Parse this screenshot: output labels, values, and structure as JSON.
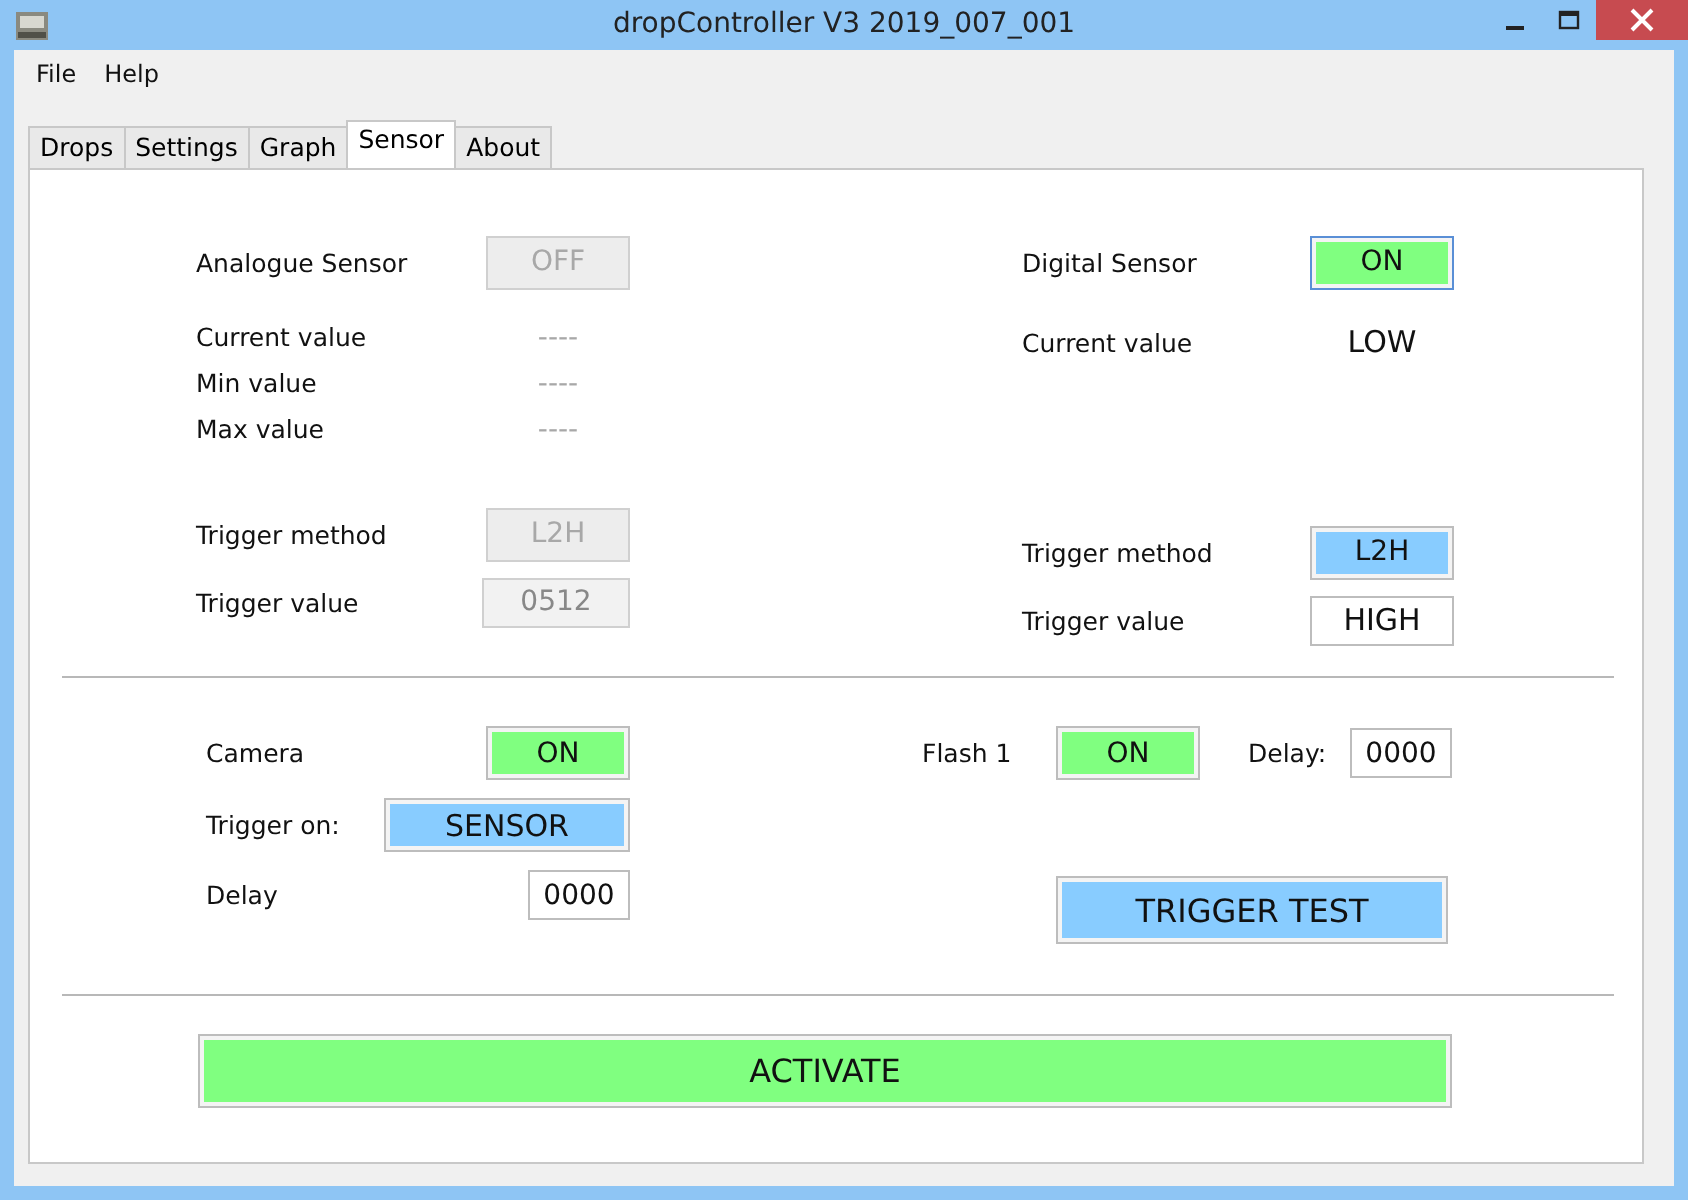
{
  "window": {
    "title": "dropController V3 2019_007_001"
  },
  "menu": [
    "File",
    "Help"
  ],
  "tabs": [
    {
      "label": "Drops",
      "selected": false
    },
    {
      "label": "Settings",
      "selected": false
    },
    {
      "label": "Graph",
      "selected": false
    },
    {
      "label": "Sensor",
      "selected": true
    },
    {
      "label": "About",
      "selected": false
    }
  ],
  "analogue_sensor": [
    [
      {
        "label": "Analogue Sensor",
        "text": "OFF",
        "kind": "disabled"
      }
    ],
    [
      {
        "label": "Current value",
        "text": "----",
        "kind": "dim"
      },
      {
        "label": "Min value",
        "text": "----",
        "kind": "dim"
      },
      {
        "label": "Max value",
        "text": "----",
        "kind": "dim"
      }
    ],
    [
      {
        "label": "Trigger method",
        "text": "L2H",
        "kind": "disabled"
      },
      {
        "label": "Trigger value",
        "text": "0512",
        "kind": "disabled-field"
      }
    ]
  ],
  "digital_sensor": [
    [
      {
        "label": "Digital Sensor",
        "text": "ON",
        "kind": "green-focus"
      }
    ],
    [
      {
        "label": "Current value",
        "text": "LOW",
        "kind": "readout"
      }
    ],
    [
      {
        "label": "Trigger method",
        "text": "L2H",
        "kind": "blue"
      },
      {
        "label": "Trigger value",
        "text": "HIGH",
        "kind": "box"
      }
    ]
  ],
  "camera": [
    {
      "label": "Camera",
      "text": "ON",
      "kind": "green"
    },
    {
      "label": "Trigger on:",
      "text": "SENSOR",
      "kind": "blue-wide"
    },
    {
      "label": "Delay",
      "text": "0000",
      "kind": "field"
    }
  ],
  "flash": {
    "label": "Flash 1",
    "text": "ON",
    "kind": "green",
    "delay_label": "Delay:",
    "delay": "0000"
  },
  "trigger_test": "TRIGGER TEST",
  "activate": "ACTIVATE"
}
